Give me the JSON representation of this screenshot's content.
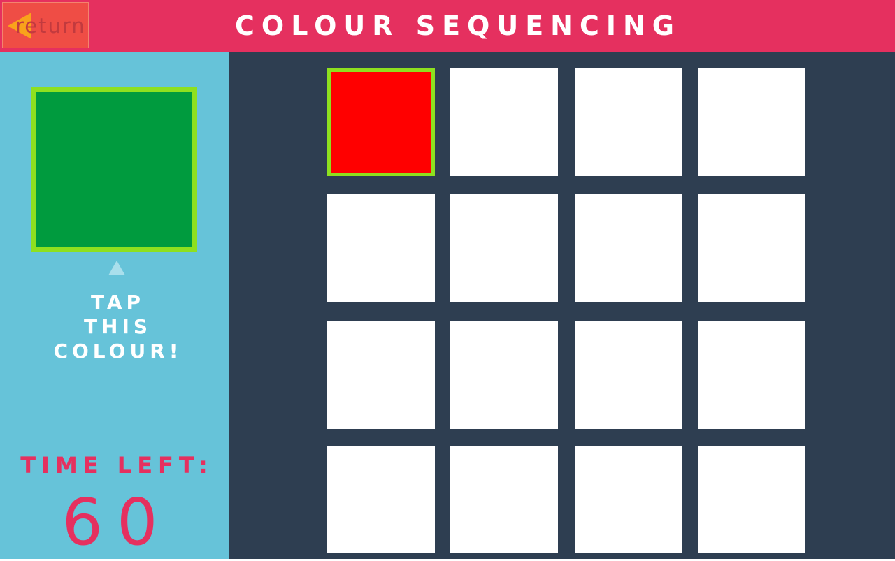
{
  "header": {
    "title": "COLOUR SEQUENCING",
    "return_label": "return"
  },
  "target": {
    "color": "#009b3e",
    "instruction_lines": [
      "TAP",
      "THIS",
      "COLOUR!"
    ]
  },
  "timer": {
    "label": "TIME LEFT:",
    "value": "60"
  },
  "grid": {
    "rows": 4,
    "columns": 4,
    "tiles": [
      {
        "color": "#ff0000",
        "selected": true
      },
      {
        "color": "#ffffff",
        "selected": false
      },
      {
        "color": "#ffffff",
        "selected": false
      },
      {
        "color": "#ffffff",
        "selected": false
      },
      {
        "color": "#ffffff",
        "selected": false
      },
      {
        "color": "#ffffff",
        "selected": false
      },
      {
        "color": "#ffffff",
        "selected": false
      },
      {
        "color": "#ffffff",
        "selected": false
      },
      {
        "color": "#ffffff",
        "selected": false
      },
      {
        "color": "#ffffff",
        "selected": false
      },
      {
        "color": "#ffffff",
        "selected": false
      },
      {
        "color": "#ffffff",
        "selected": false
      },
      {
        "color": "#ffffff",
        "selected": false
      },
      {
        "color": "#ffffff",
        "selected": false
      },
      {
        "color": "#ffffff",
        "selected": false
      },
      {
        "color": "#ffffff",
        "selected": false
      }
    ]
  },
  "colors": {
    "header_bg": "#e5305f",
    "sidebar_bg": "#66c3d9",
    "board_bg": "#2e3e51",
    "highlight_border": "#8ee01f"
  }
}
